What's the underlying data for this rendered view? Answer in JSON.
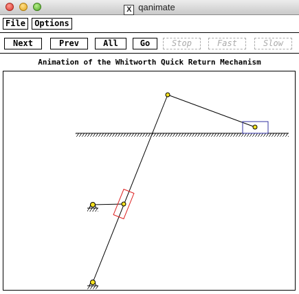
{
  "window": {
    "title": "qanimate",
    "x_icon": "X"
  },
  "menu": {
    "file": "File",
    "options": "Options"
  },
  "toolbar": {
    "next": "Next",
    "prev": "Prev",
    "all": "All",
    "go": "Go",
    "stop": "Stop",
    "fast": "Fast",
    "slow": "Slow"
  },
  "caption": "Animation of the Whitworth Quick Return Mechanism",
  "colors": {
    "link": "#000000",
    "slider_block": "#dd2020",
    "ram_block": "#3030a0",
    "joint": "#f4e020"
  }
}
